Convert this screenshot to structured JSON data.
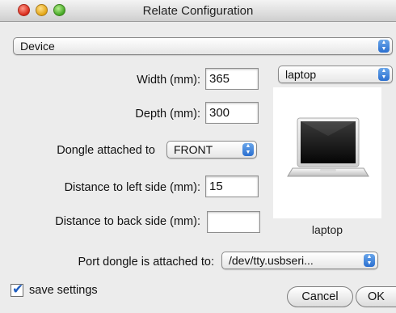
{
  "window": {
    "title": "Relate Configuration"
  },
  "device_popup": {
    "value": "Device"
  },
  "fields": {
    "width_label": "Width (mm):",
    "width_value": "365",
    "depth_label": "Depth (mm):",
    "depth_value": "300",
    "dongle_label": "Dongle attached to",
    "dongle_value": "FRONT",
    "left_label": "Distance to left side (mm):",
    "left_value": "15",
    "back_label": "Distance to back side (mm):",
    "back_value": "",
    "port_label": "Port dongle is attached to:",
    "port_value": "/dev/tty.usbseri..."
  },
  "preview": {
    "type_value": "laptop",
    "caption": "laptop",
    "icon": "laptop-icon"
  },
  "footer": {
    "save_label": "save settings",
    "save_checked": true,
    "cancel_label": "Cancel",
    "ok_label": "OK"
  },
  "colors": {
    "accent": "#2a6fd0",
    "background": "#ececec"
  }
}
